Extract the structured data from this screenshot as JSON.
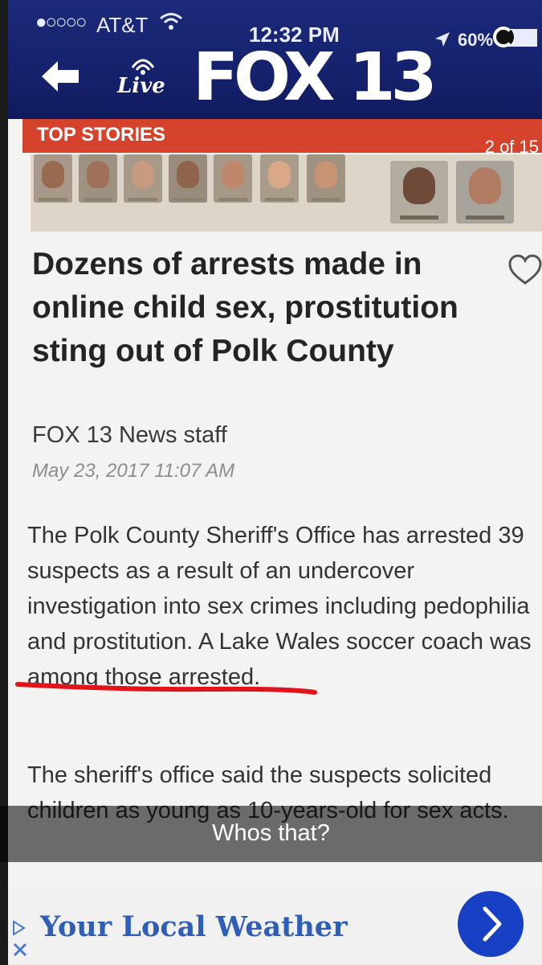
{
  "status_bar": {
    "signal": "●○○○○",
    "carrier": "AT&T",
    "time": "12:32 PM",
    "battery": "60%"
  },
  "header": {
    "live_label": "Live",
    "logo_text": "FOX 13"
  },
  "top_stories": {
    "label": "TOP STORIES",
    "count": "2 of 15"
  },
  "article": {
    "headline": "Dozens of arrests made in online child sex, prostitution sting out of Polk County",
    "byline": "FOX 13 News staff",
    "date": "May 23, 2017 11:07 AM",
    "paragraph1": "The Polk County Sheriff's Office has arrested 39 suspects as a result of an undercover investigation into sex crimes including pedophilia and prostitution. A Lake Wales soccer coach was among those arrested.",
    "paragraph2": "The sheriff's office said the suspects solicited children as young as 10-years-old for sex acts."
  },
  "caption": "Whos that?",
  "ad": {
    "text": "Your Local Weather"
  },
  "colors": {
    "header_blue": "#14206a",
    "top_stories_red": "#d6432d",
    "annotation_red": "#e0141a",
    "ad_button_blue": "#1840c5",
    "ad_text_blue": "#2f5eb7"
  }
}
